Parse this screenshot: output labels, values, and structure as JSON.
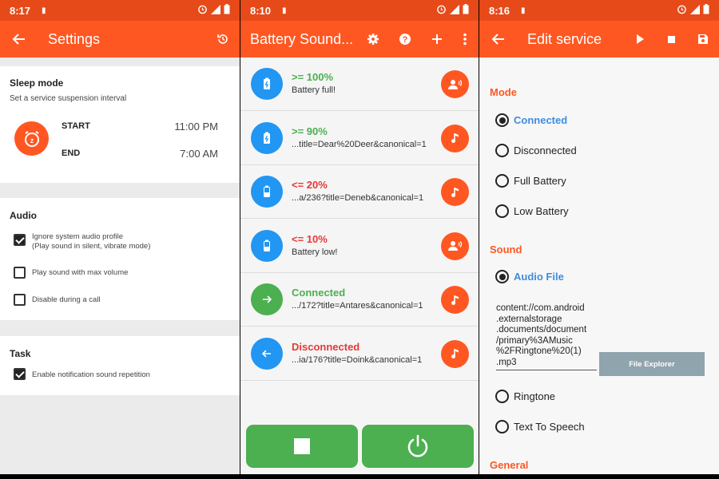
{
  "settings": {
    "status_time": "8:17",
    "title": "Settings",
    "sleep": {
      "header": "Sleep mode",
      "desc": "Set a service suspension interval",
      "start_label": "START",
      "start_time": "11:00 PM",
      "end_label": "END",
      "end_time": "7:00 AM"
    },
    "audio": {
      "header": "Audio",
      "opt1_line1": "Ignore system audio profile",
      "opt1_line2": "(Play sound in silent, vibrate mode)",
      "opt1_checked": true,
      "opt2": "Play sound with max volume",
      "opt2_checked": false,
      "opt3": "Disable during a call",
      "opt3_checked": false
    },
    "task": {
      "header": "Task",
      "opt1": "Enable notification sound repetition",
      "opt1_checked": true
    }
  },
  "list": {
    "status_time": "8:10",
    "title": "Battery Sound...",
    "items": [
      {
        "title": ">= 100%",
        "subtitle": "Battery full!",
        "title_color": "green",
        "icon": "battery-full-icon",
        "icon_color": "#2196f3",
        "action_icon": "speaker-person-icon"
      },
      {
        "title": ">= 90%",
        "subtitle": "...title=Dear%20Deer&canonical=1",
        "title_color": "green",
        "icon": "battery-high-icon",
        "icon_color": "#2196f3",
        "action_icon": "music-note-icon"
      },
      {
        "title": "<= 20%",
        "subtitle": "...a/236?title=Deneb&canonical=1",
        "title_color": "red",
        "icon": "battery-low-icon",
        "icon_color": "#2196f3",
        "action_icon": "music-note-icon"
      },
      {
        "title": "<= 10%",
        "subtitle": "Battery low!",
        "title_color": "red",
        "icon": "battery-low-icon",
        "icon_color": "#2196f3",
        "action_icon": "speaker-person-icon"
      },
      {
        "title": "Connected",
        "subtitle": ".../172?title=Antares&canonical=1",
        "title_color": "green",
        "icon": "arrow-right-icon",
        "icon_color": "#4caf50",
        "action_icon": "music-note-icon"
      },
      {
        "title": "Disconnected",
        "subtitle": "...ia/176?title=Doink&canonical=1",
        "title_color": "red",
        "icon": "arrow-left-icon",
        "icon_color": "#2196f3",
        "action_icon": "music-note-icon"
      }
    ]
  },
  "edit": {
    "status_time": "8:16",
    "title": "Edit service",
    "mode_header": "Mode",
    "modes": [
      "Connected",
      "Disconnected",
      "Full Battery",
      "Low Battery"
    ],
    "mode_selected": "Connected",
    "sound_header": "Sound",
    "audio_file_label": "Audio File",
    "audio_path": "content://com.android.externalstorage.documents/document/primary%3AMusic%2FRingtone%20(1).mp3",
    "audio_path_lines": [
      "content://com.android",
      ".externalstorage",
      ".documents/document",
      "/primary%3AMusic",
      "%2FRingtone%20(1)",
      ".mp3"
    ],
    "file_explorer": "File Explorer",
    "ringtone_label": "Ringtone",
    "tts_label": "Text To Speech",
    "general_header": "General"
  },
  "colors": {
    "appbar": "#ff5722",
    "statusbar": "#e64a19",
    "green": "#4caf50",
    "red": "#e53935",
    "blue": "#2196f3",
    "selected_blue": "#3d8ddf"
  }
}
